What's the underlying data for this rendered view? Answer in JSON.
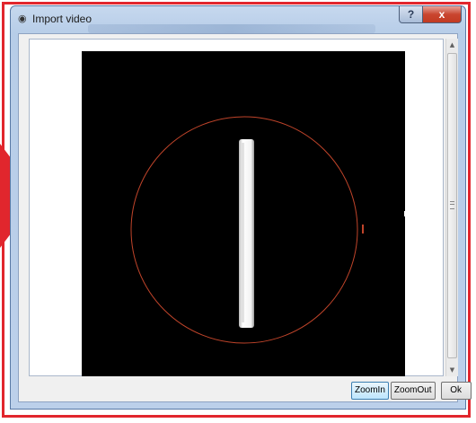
{
  "window": {
    "title": "Import video",
    "title_icon": "camera-icon",
    "help_label": "?",
    "close_label": "x"
  },
  "buttons": {
    "zoom_in": "ZoomIn",
    "zoom_out": "ZoomOut",
    "ok": "Ok"
  },
  "colors": {
    "frame_accent": "#e1262d",
    "circle": "#c0442a",
    "video_bg": "#000000"
  }
}
